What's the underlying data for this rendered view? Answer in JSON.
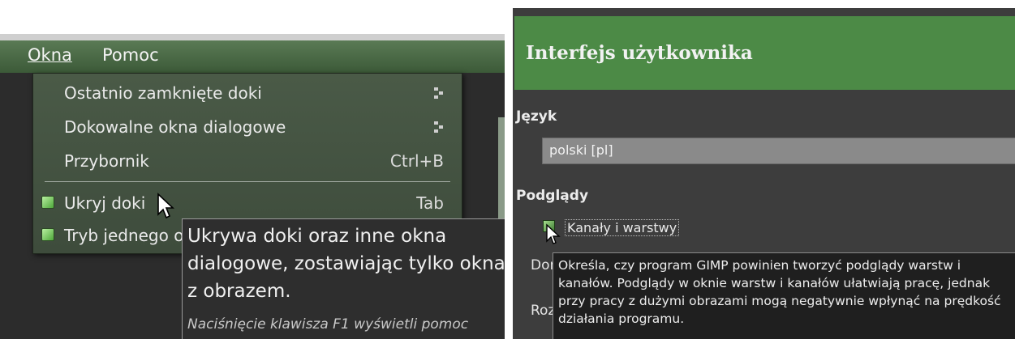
{
  "left": {
    "menubar": {
      "items": [
        {
          "label": "Okna",
          "mnemonic_index": 0
        },
        {
          "label": "Pomoc",
          "mnemonic_index": 4
        }
      ]
    },
    "menu": {
      "items": [
        {
          "label": "Ostatnio zamknięte doki",
          "submenu": true
        },
        {
          "label": "Dokowalne okna dialogowe",
          "submenu": true
        },
        {
          "label": "Przybornik",
          "shortcut": "Ctrl+B"
        },
        {
          "label": "Ukryj doki",
          "shortcut": "Tab",
          "checked": true
        },
        {
          "label": "Tryb jednego o",
          "checked": true
        }
      ]
    },
    "tooltip": {
      "text": "Ukrywa doki oraz inne okna dialogowe, zostawiając tylko okna z obrazem.",
      "hint": "Naciśnięcie klawisza F1 wyświetli pomoc"
    }
  },
  "right": {
    "title": "Interfejs użytkownika",
    "language": {
      "heading": "Język",
      "value": "polski [pl]"
    },
    "previews": {
      "heading": "Podglądy",
      "checkbox_label": "Kanały i warstwy",
      "checked": true
    },
    "truncated_labels": [
      "Dom",
      "Roz"
    ],
    "tooltip": {
      "text": "Określa, czy program GIMP powinien tworzyć podglądy warstw i kanałów. Podglądy w oknie warstw i kanałów ułatwiają pracę, jednak przy pracy z dużymi obrazami mogą negatywnie wpłynąć na prędkość działania programu."
    }
  },
  "colors": {
    "menubar_green": "#3c5a38",
    "header_green": "#4c8a46",
    "dark_bg": "#3d3d3d"
  }
}
